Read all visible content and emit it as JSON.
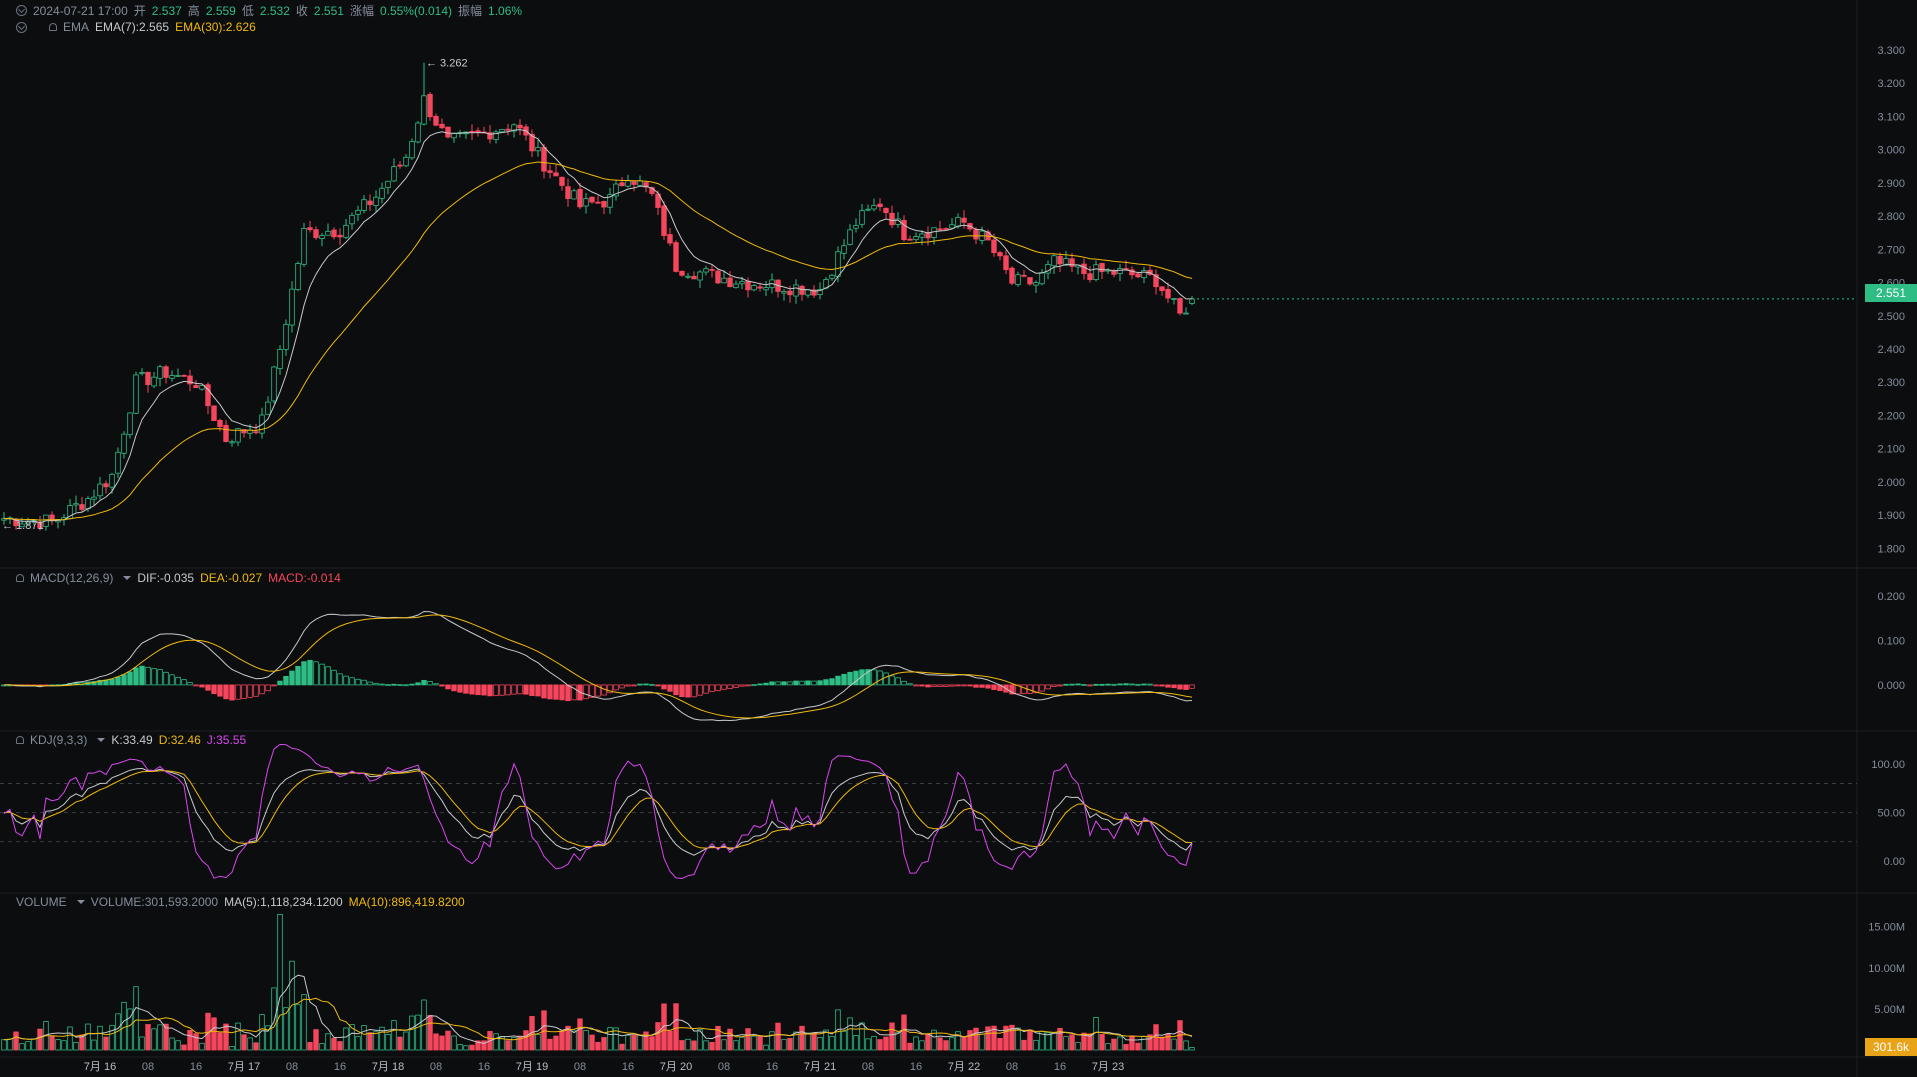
{
  "header": {
    "datetime": "2024-07-21 17:00",
    "open_label": "开",
    "open": "2.537",
    "high_label": "高",
    "high": "2.559",
    "low_label": "低",
    "low": "2.532",
    "close_label": "收",
    "close": "2.551",
    "change_label": "涨幅",
    "change": "0.55%(0.014)",
    "amplitude_label": "振幅",
    "amplitude": "1.06%"
  },
  "ema_header": {
    "name": "EMA",
    "ema7": "EMA(7):2.565",
    "ema30": "EMA(30):2.626"
  },
  "macd_header": {
    "name": "MACD(12,26,9)",
    "dif": "DIF:-0.035",
    "dea": "DEA:-0.027",
    "macd": "MACD:-0.014"
  },
  "kdj_header": {
    "name": "KDJ(9,3,3)",
    "k": "K:33.49",
    "d": "D:32.46",
    "j": "J:35.55"
  },
  "volume_header": {
    "name": "VOLUME",
    "volume": "VOLUME:301,593.2000",
    "ma5": "MA(5):1,118,234.1200",
    "ma10": "MA(10):896,419.8200"
  },
  "price_tags": {
    "current": "2.551",
    "volume": "301.6k"
  },
  "colors": {
    "up": "#2ebd85",
    "down": "#f6465d",
    "ema7": "#c7c9cc",
    "ema30": "#f0b90b",
    "j": "#d946ef",
    "bg": "#0c0d0f"
  },
  "chart_data": [
    {
      "type": "candlestick",
      "panel": "price",
      "ylim": [
        1.75,
        3.33
      ],
      "yticks": [
        "1.800",
        "1.900",
        "2.000",
        "2.100",
        "2.200",
        "2.300",
        "2.400",
        "2.500",
        "2.600",
        "2.700",
        "2.800",
        "2.900",
        "3.000",
        "3.100",
        "3.200",
        "3.300"
      ],
      "xticks": [
        "7月 16",
        "08",
        "16",
        "7月 17",
        "08",
        "16",
        "7月 18",
        "08",
        "16",
        "7月 19",
        "08",
        "16",
        "7月 20",
        "08",
        "16",
        "7月 21",
        "08",
        "16",
        "7月 22",
        "08",
        "16",
        "7月 23"
      ],
      "annotations": {
        "high": "3.262",
        "low": "1.871"
      },
      "series": [
        {
          "name": "EMA(7)"
        },
        {
          "name": "EMA(30)"
        }
      ],
      "close_anchors": [
        [
          0,
          1.89
        ],
        [
          8,
          1.88
        ],
        [
          14,
          1.95
        ],
        [
          18,
          2.02
        ],
        [
          22,
          2.3
        ],
        [
          27,
          2.33
        ],
        [
          32,
          2.3
        ],
        [
          37,
          2.13
        ],
        [
          43,
          2.18
        ],
        [
          46,
          2.4
        ],
        [
          50,
          2.75
        ],
        [
          56,
          2.76
        ],
        [
          62,
          2.86
        ],
        [
          67,
          2.98
        ],
        [
          70,
          3.15
        ],
        [
          74,
          3.02
        ],
        [
          80,
          3.05
        ],
        [
          85,
          3.08
        ],
        [
          90,
          2.96
        ],
        [
          96,
          2.83
        ],
        [
          101,
          2.85
        ],
        [
          104,
          2.93
        ],
        [
          108,
          2.86
        ],
        [
          112,
          2.65
        ],
        [
          118,
          2.62
        ],
        [
          124,
          2.6
        ],
        [
          130,
          2.59
        ],
        [
          136,
          2.58
        ],
        [
          142,
          2.78
        ],
        [
          146,
          2.84
        ],
        [
          150,
          2.75
        ],
        [
          155,
          2.76
        ],
        [
          160,
          2.78
        ],
        [
          164,
          2.72
        ],
        [
          168,
          2.6
        ],
        [
          172,
          2.6
        ],
        [
          175,
          2.66
        ],
        [
          180,
          2.63
        ],
        [
          186,
          2.63
        ],
        [
          192,
          2.61
        ],
        [
          196,
          2.5
        ],
        [
          198,
          2.551
        ]
      ]
    },
    {
      "type": "macd",
      "panel": "macd",
      "ylim": [
        -0.09,
        0.24
      ],
      "yticks": [
        "0.000",
        "0.100",
        "0.200"
      ]
    },
    {
      "type": "kdj",
      "panel": "kdj",
      "ylim": [
        -30,
        125
      ],
      "yticks": [
        "0.00",
        "50.00",
        "100.00"
      ],
      "guides": [
        20,
        50,
        80
      ]
    },
    {
      "type": "bar",
      "panel": "volume",
      "ylim": [
        0,
        18000000
      ],
      "yticks": [
        "5.00M",
        "10.00M",
        "15.00M"
      ],
      "series": [
        {
          "name": "VOLUME"
        },
        {
          "name": "MA(5)"
        },
        {
          "name": "MA(10)"
        }
      ]
    }
  ]
}
